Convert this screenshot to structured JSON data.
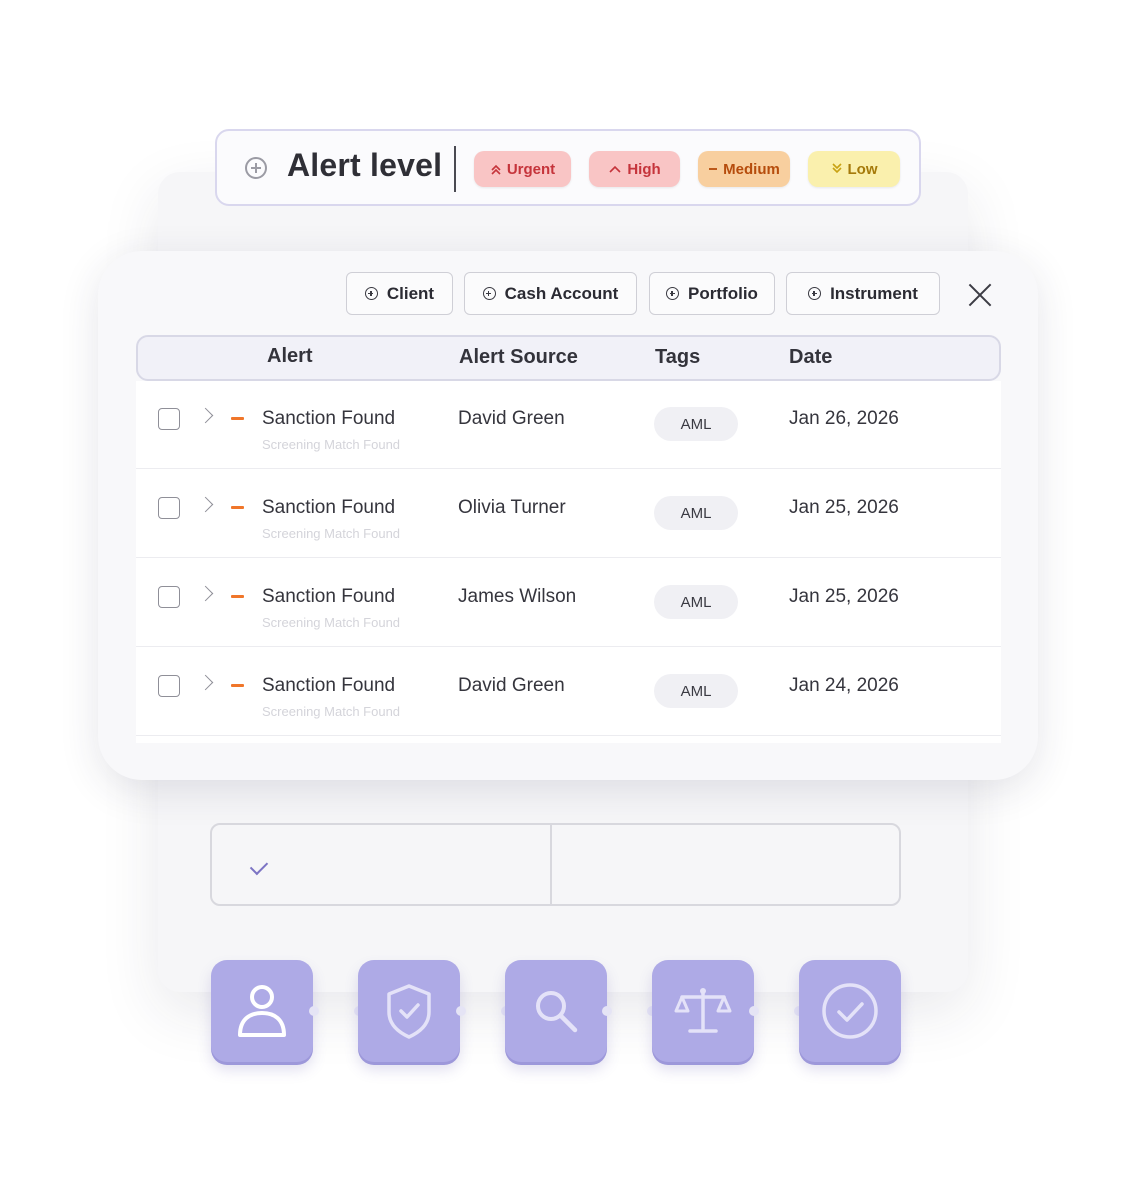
{
  "alert_level": {
    "title": "Alert level",
    "levels": [
      {
        "label": "Urgent",
        "icon": "double-chevron-up-icon",
        "color": "#c5343b"
      },
      {
        "label": "High",
        "icon": "chevron-up-icon",
        "color": "#c5343b"
      },
      {
        "label": "Medium",
        "icon": "dash-icon",
        "color": "#b64c0c"
      },
      {
        "label": "Low",
        "icon": "double-chevron-down-icon",
        "color": "#a57a0a"
      }
    ]
  },
  "filters": {
    "buttons": [
      "Client",
      "Cash Account",
      "Portfolio",
      "Instrument"
    ]
  },
  "table": {
    "headers": {
      "alert": "Alert",
      "source": "Alert Source",
      "tags": "Tags",
      "date": "Date"
    },
    "rows": [
      {
        "title": "Sanction Found",
        "subtitle": "Screening Match Found",
        "source": "David Green",
        "tag": "AML",
        "date": "Jan 26, 2026"
      },
      {
        "title": "Sanction Found",
        "subtitle": "Screening Match Found",
        "source": "Olivia Turner",
        "tag": "AML",
        "date": "Jan 25, 2026"
      },
      {
        "title": "Sanction Found",
        "subtitle": "Screening Match Found",
        "source": "James Wilson",
        "tag": "AML",
        "date": "Jan 25, 2026"
      },
      {
        "title": "Sanction Found",
        "subtitle": "Screening Match Found",
        "source": "David Green",
        "tag": "AML",
        "date": "Jan 24, 2026"
      }
    ]
  },
  "workflow_steps": [
    {
      "icon": "user-icon"
    },
    {
      "icon": "shield-check-icon"
    },
    {
      "icon": "search-icon"
    },
    {
      "icon": "scales-icon"
    },
    {
      "icon": "check-circle-icon"
    }
  ],
  "colors": {
    "accent": "#aeaae6",
    "medium_dash": "#f0762a"
  }
}
